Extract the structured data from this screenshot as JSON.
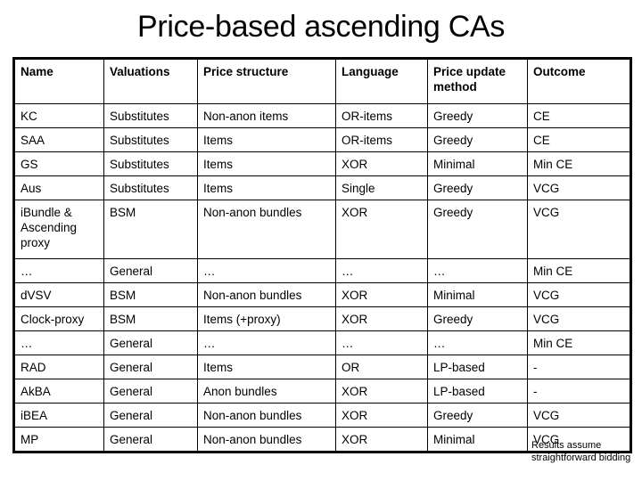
{
  "slide": {
    "title": "Price-based ascending CAs",
    "footnote": "Results assume straightforward bidding"
  },
  "table": {
    "headers": [
      "Name",
      "Valuations",
      "Price structure",
      "Language",
      "Price update method",
      "Outcome"
    ],
    "rows": [
      {
        "tall": false,
        "cells": [
          "KC",
          "Substitutes",
          "Non-anon items",
          "OR-items",
          "Greedy",
          "CE"
        ]
      },
      {
        "tall": false,
        "cells": [
          "SAA",
          "Substitutes",
          "Items",
          "OR-items",
          "Greedy",
          "CE"
        ]
      },
      {
        "tall": false,
        "cells": [
          "GS",
          "Substitutes",
          "Items",
          "XOR",
          "Minimal",
          "Min CE"
        ]
      },
      {
        "tall": false,
        "cells": [
          "Aus",
          "Substitutes",
          "Items",
          "Single",
          "Greedy",
          "VCG"
        ]
      },
      {
        "tall": true,
        "cells": [
          "iBundle & Ascending proxy",
          "BSM",
          "Non-anon bundles",
          "XOR",
          "Greedy",
          "VCG"
        ]
      },
      {
        "tall": false,
        "cells": [
          "…",
          "General",
          "…",
          "…",
          "…",
          "Min CE"
        ]
      },
      {
        "tall": false,
        "cells": [
          "dVSV",
          "BSM",
          "Non-anon bundles",
          "XOR",
          "Minimal",
          "VCG"
        ]
      },
      {
        "tall": false,
        "cells": [
          "Clock-proxy",
          "BSM",
          "Items (+proxy)",
          "XOR",
          "Greedy",
          "VCG"
        ]
      },
      {
        "tall": false,
        "cells": [
          "…",
          "General",
          "…",
          "…",
          "…",
          "Min CE"
        ]
      },
      {
        "tall": false,
        "cells": [
          "RAD",
          "General",
          "Items",
          "OR",
          "LP-based",
          "-"
        ]
      },
      {
        "tall": false,
        "cells": [
          "AkBA",
          "General",
          "Anon bundles",
          "XOR",
          "LP-based",
          "-"
        ]
      },
      {
        "tall": false,
        "cells": [
          "iBEA",
          "General",
          "Non-anon bundles",
          "XOR",
          "Greedy",
          "VCG"
        ]
      },
      {
        "tall": false,
        "cells": [
          "MP",
          "General",
          "Non-anon bundles",
          "XOR",
          "Minimal",
          "VCG"
        ]
      }
    ]
  },
  "colors": {
    "background": "#ffffff",
    "text": "#000000",
    "border": "#000000"
  }
}
